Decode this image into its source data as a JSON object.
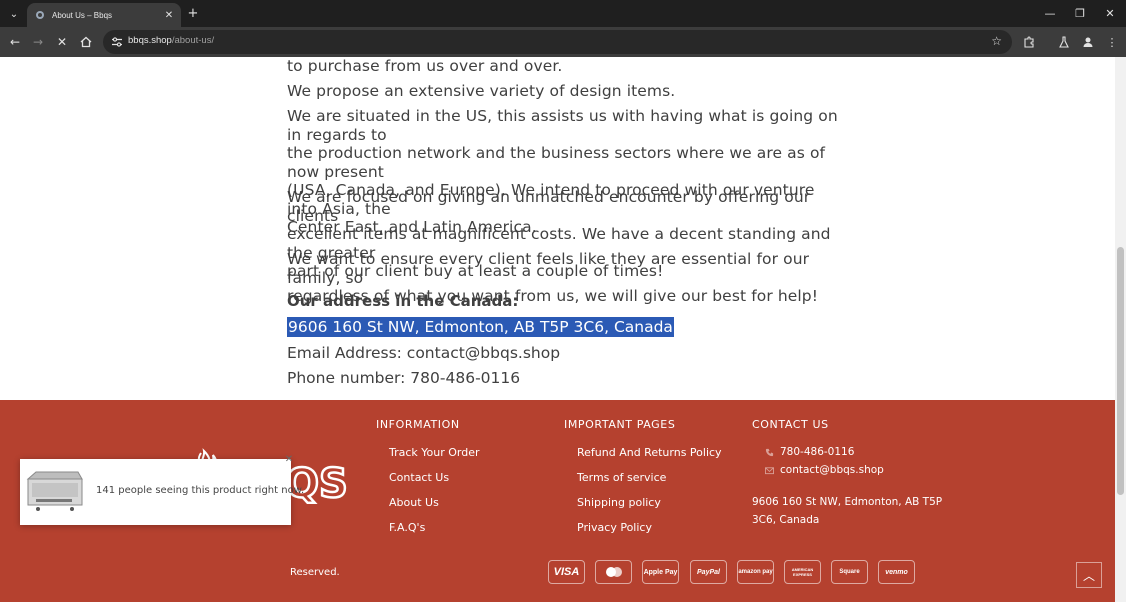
{
  "browser": {
    "tab_title": "About Us – Bbqs",
    "url_host": "bbqs.shop",
    "url_path": "/about-us/"
  },
  "content": {
    "paragraphs": [
      [
        "to purchase from us over and over."
      ],
      [
        "We propose an extensive variety of design items."
      ],
      [
        "We are situated in the US, this assists us with having what is going on in regards to",
        "the production network and the business sectors where we are as of now present",
        "(USA, Canada, and Europe). We intend to proceed with our venture into Asia, the",
        "Center East, and Latin America."
      ],
      [
        "We are focused on giving an unmatched encounter by offering our clients",
        "excellent items at magnificent costs. We have a decent standing and the greater",
        "part of our client buy at least a couple of times!"
      ],
      [
        "We want to ensure every client feels like they are essential for our family, so",
        "regardless of what you want from us, we will give our best for help!"
      ]
    ],
    "address_heading": "Our address in the Canada:",
    "address": "9606 160 St NW, Edmonton, AB T5P 3C6, Canada",
    "email": "Email Address: contact@bbqs.shop",
    "phone": "Phone number: 780-486-0116"
  },
  "footer": {
    "logo_text": "BBQS",
    "information": {
      "title": "INFORMATION",
      "links": [
        "Track Your Order",
        "Contact Us",
        "About Us",
        "F.A.Q's"
      ]
    },
    "important": {
      "title": "IMPORTANT PAGES",
      "links": [
        "Refund And Returns Policy",
        "Terms of service",
        "Shipping policy",
        "Privacy Policy"
      ]
    },
    "contact": {
      "title": "CONTACT US",
      "phone": "780-486-0116",
      "email": "contact@bbqs.shop",
      "address_line1": "9606 160 St NW, Edmonton, AB T5P",
      "address_line2": "3C6, Canada"
    },
    "copyright": "Reserved.",
    "payments": [
      "VISA",
      "mastercard",
      "Apple Pay",
      "PayPal",
      "amazon pay",
      "AMERICAN EXPRESS",
      "Square",
      "venmo"
    ]
  },
  "popup": {
    "text": "141 people seeing this product right now."
  },
  "colors": {
    "footer_bg": "#b5412f",
    "selection": "#2b5ab5",
    "chrome_dark": "#1f1f1f",
    "toolbar": "#3c3c3c"
  }
}
